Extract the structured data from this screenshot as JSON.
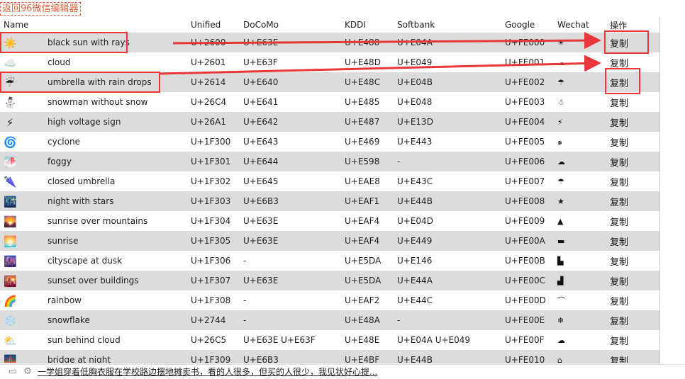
{
  "back_link": "返回96微信编辑器",
  "columns": [
    "Name",
    "Unified",
    "DoCoMo",
    "KDDI",
    "Softbank",
    "Google",
    "Wechat",
    "操作"
  ],
  "copy_label": "复制",
  "highlight_color": "#e8373b",
  "rows": [
    {
      "icon": "☀️",
      "name": "black sun with rays",
      "unified": "U+2600",
      "docomo": "U+E63E",
      "kddi": "U+E488",
      "softbank": "U+E04A",
      "google": "U+FE000",
      "wechat": "☀"
    },
    {
      "icon": "☁️",
      "name": "cloud",
      "unified": "U+2601",
      "docomo": "U+E63F",
      "kddi": "U+E48D",
      "softbank": "U+E049",
      "google": "U+FE001",
      "wechat": "☁"
    },
    {
      "icon": "☔",
      "name": "umbrella with rain drops",
      "unified": "U+2614",
      "docomo": "U+E640",
      "kddi": "U+E48C",
      "softbank": "U+E04B",
      "google": "U+FE002",
      "wechat": "☂"
    },
    {
      "icon": "⛄",
      "name": "snowman without snow",
      "unified": "U+26C4",
      "docomo": "U+E641",
      "kddi": "U+E485",
      "softbank": "U+E048",
      "google": "U+FE003",
      "wechat": "☃"
    },
    {
      "icon": "⚡",
      "name": "high voltage sign",
      "unified": "U+26A1",
      "docomo": "U+E642",
      "kddi": "U+E487",
      "softbank": "U+E13D",
      "google": "U+FE004",
      "wechat": "⚡"
    },
    {
      "icon": "🌀",
      "name": "cyclone",
      "unified": "U+1F300",
      "docomo": "U+E643",
      "kddi": "U+E469",
      "softbank": "U+E443",
      "google": "U+FE005",
      "wechat": "๑"
    },
    {
      "icon": "🌁",
      "name": "foggy",
      "unified": "U+1F301",
      "docomo": "U+E644",
      "kddi": "U+E598",
      "softbank": "-",
      "google": "U+FE006",
      "wechat": "☁"
    },
    {
      "icon": "🌂",
      "name": "closed umbrella",
      "unified": "U+1F302",
      "docomo": "U+E645",
      "kddi": "U+EAE8",
      "softbank": "U+E43C",
      "google": "U+FE007",
      "wechat": "☂"
    },
    {
      "icon": "🌃",
      "name": "night with stars",
      "unified": "U+1F303",
      "docomo": "U+E6B3",
      "kddi": "U+EAF1",
      "softbank": "U+E44B",
      "google": "U+FE008",
      "wechat": "★"
    },
    {
      "icon": "🌄",
      "name": "sunrise over mountains",
      "unified": "U+1F304",
      "docomo": "U+E63E",
      "kddi": "U+EAF4",
      "softbank": "U+E04D",
      "google": "U+FE009",
      "wechat": "▲"
    },
    {
      "icon": "🌅",
      "name": "sunrise",
      "unified": "U+1F305",
      "docomo": "U+E63E",
      "kddi": "U+EAF4",
      "softbank": "U+E449",
      "google": "U+FE00A",
      "wechat": "▬"
    },
    {
      "icon": "🌆",
      "name": "cityscape at dusk",
      "unified": "U+1F306",
      "docomo": "-",
      "kddi": "U+E5DA",
      "softbank": "U+E146",
      "google": "U+FE00B",
      "wechat": "▙"
    },
    {
      "icon": "🌇",
      "name": "sunset over buildings",
      "unified": "U+1F307",
      "docomo": "U+E63E",
      "kddi": "U+E5DA",
      "softbank": "U+E44A",
      "google": "U+FE00C",
      "wechat": "▟"
    },
    {
      "icon": "🌈",
      "name": "rainbow",
      "unified": "U+1F308",
      "docomo": "-",
      "kddi": "U+EAF2",
      "softbank": "U+E44C",
      "google": "U+FE00D",
      "wechat": "⌒"
    },
    {
      "icon": "❄️",
      "name": "snowflake",
      "unified": "U+2744",
      "docomo": "-",
      "kddi": "U+E48A",
      "softbank": "-",
      "google": "U+FE00E",
      "wechat": "❄"
    },
    {
      "icon": "⛅",
      "name": "sun behind cloud",
      "unified": "U+26C5",
      "docomo": "U+E63E U+E63F",
      "kddi": "U+E48E",
      "softbank": "U+E04A U+E049",
      "google": "U+FE00F",
      "wechat": "☁"
    },
    {
      "icon": "🌉",
      "name": "bridge at night",
      "unified": "U+1F309",
      "docomo": "U+E6B3",
      "kddi": "U+E4BF",
      "softbank": "U+E44B",
      "google": "U+FE010",
      "wechat": "⌂"
    }
  ],
  "status_bar": {
    "camera_icon": "camera-icon",
    "gear_icon": "gear-icon",
    "news_text": "一学姐穿着低胸衣服在学校路边摆地摊卖书，看的人很多，但买的人很少，我见状好心提..."
  }
}
